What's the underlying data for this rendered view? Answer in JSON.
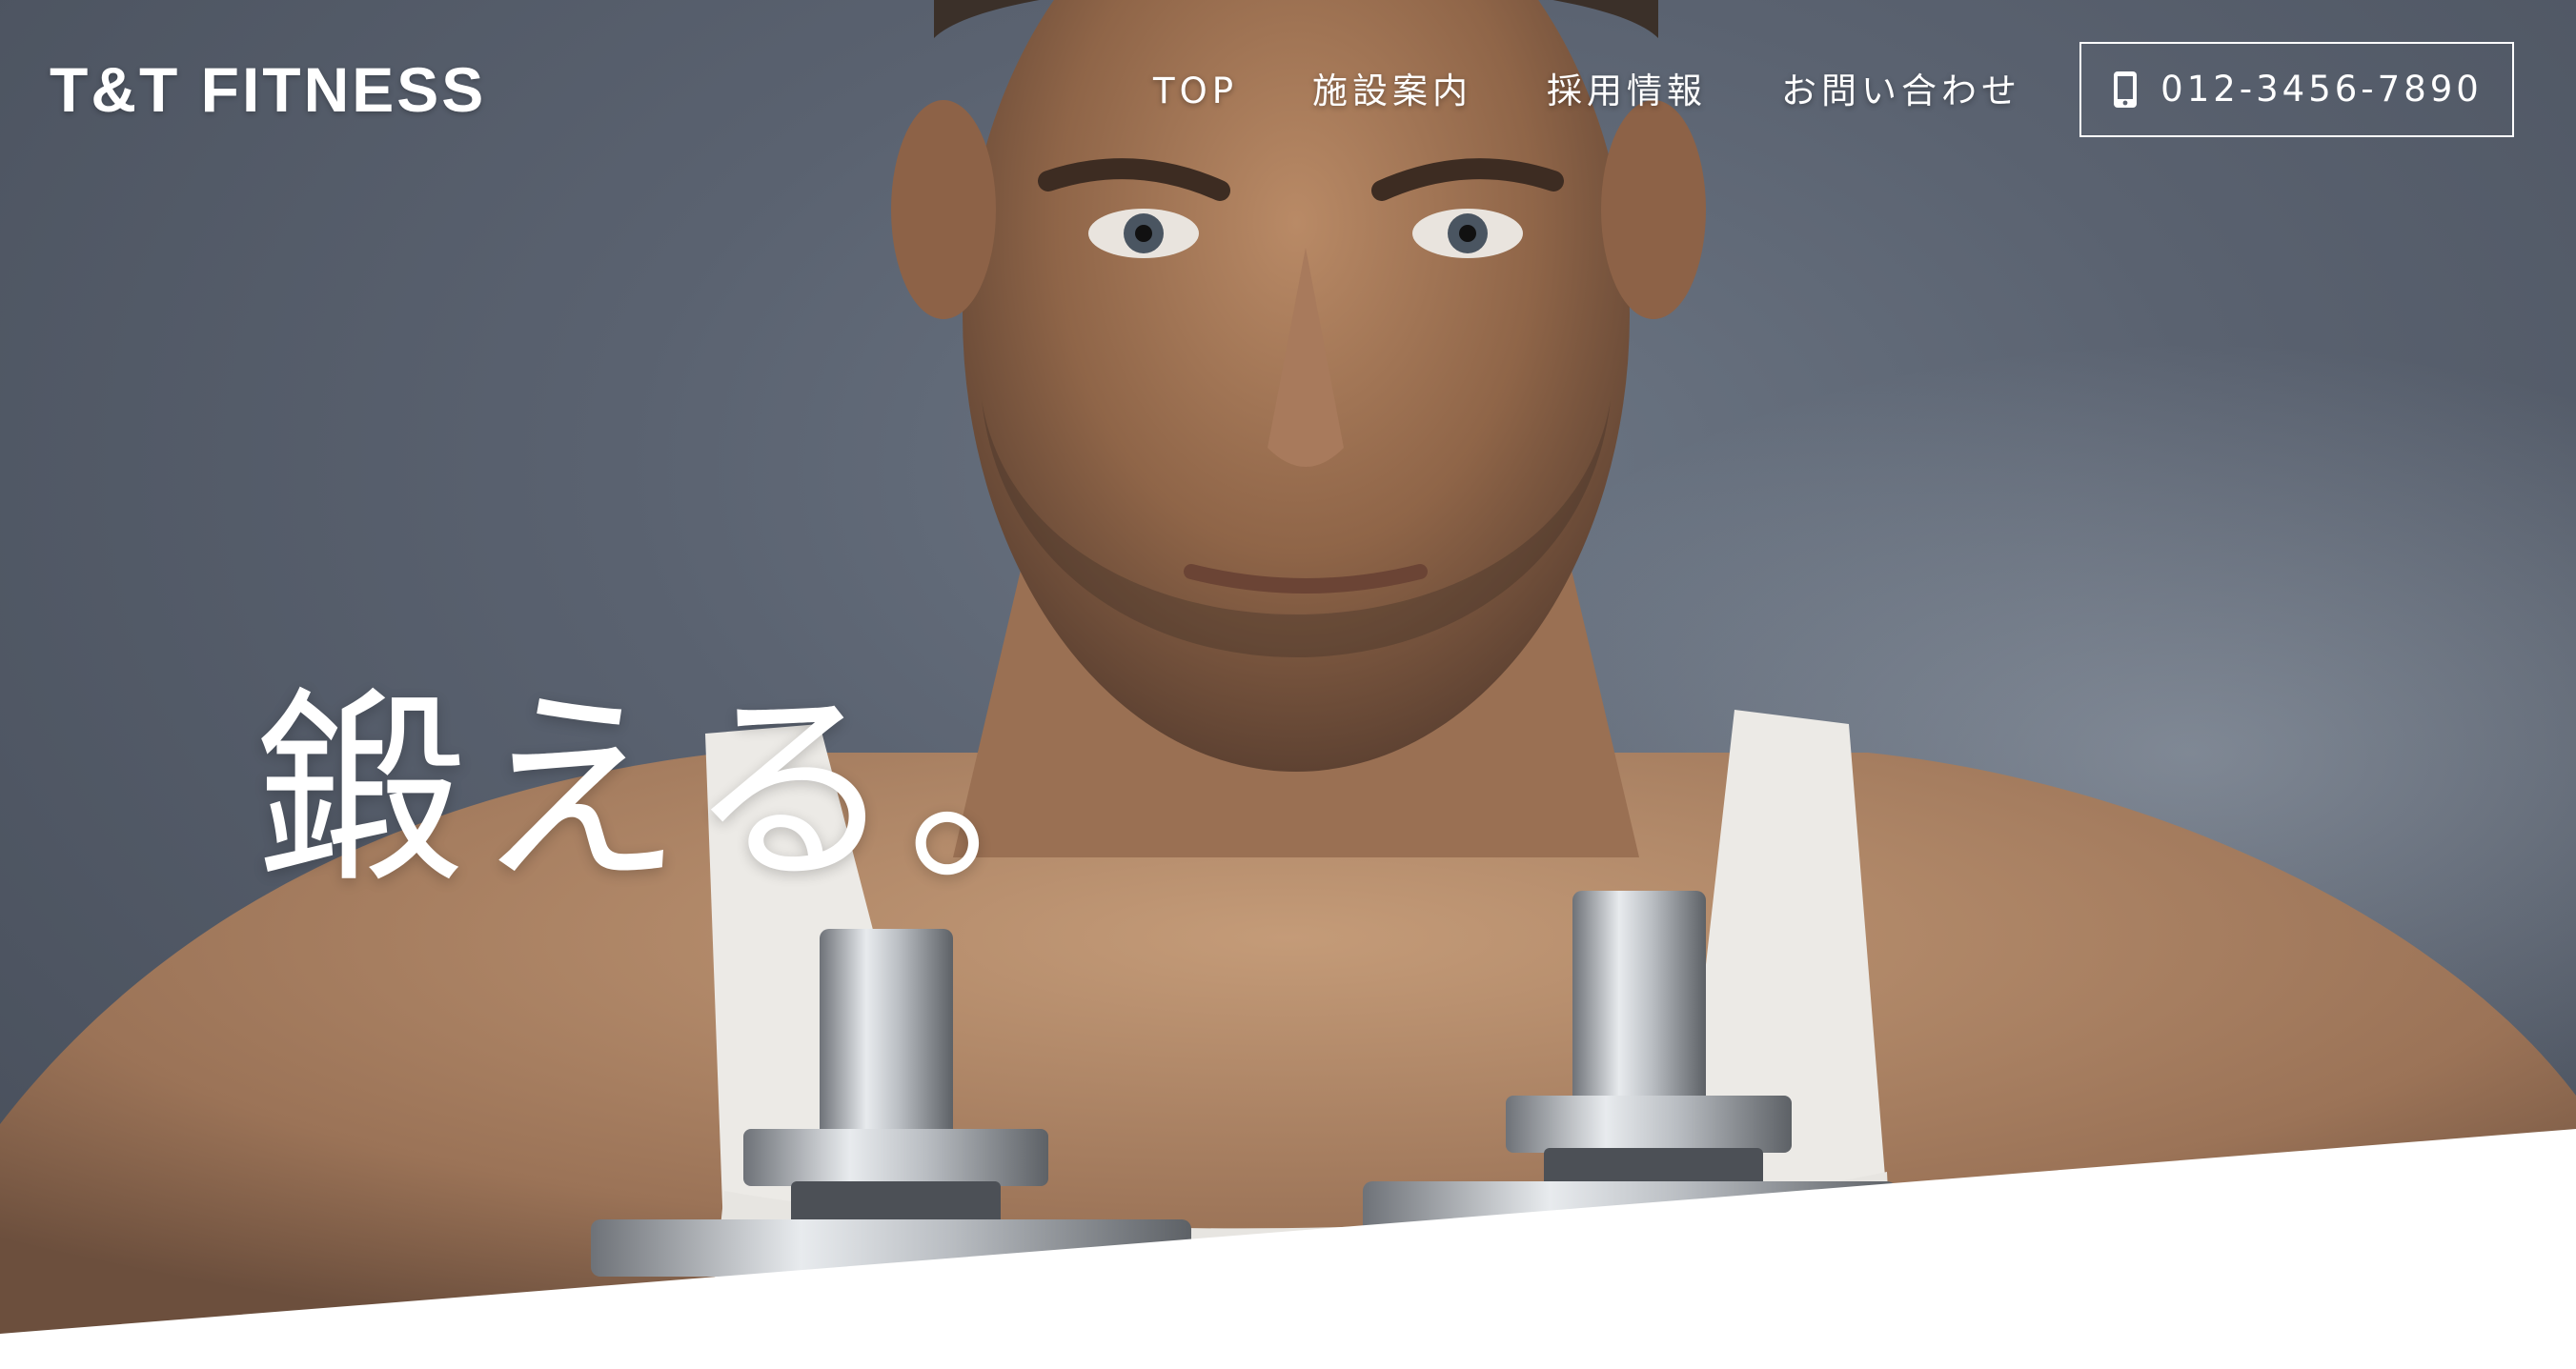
{
  "site": {
    "logo": "T&T FITNESS"
  },
  "nav": {
    "items": [
      {
        "label": "TOP"
      },
      {
        "label": "施設案内"
      },
      {
        "label": "採用情報"
      },
      {
        "label": "お問い合わせ"
      }
    ]
  },
  "contact": {
    "phone": "012-3456-7890",
    "icon": "smartphone-icon"
  },
  "hero": {
    "catchcopy": "鍛える。",
    "background_color": "#5a6270"
  },
  "colors": {
    "text": "#ffffff",
    "page_background": "#ffffff"
  }
}
